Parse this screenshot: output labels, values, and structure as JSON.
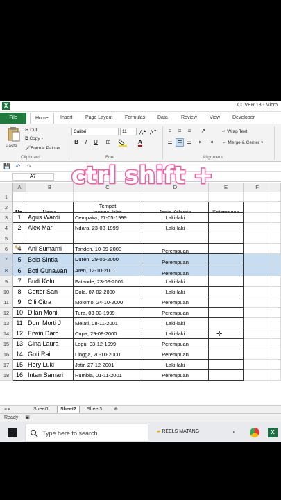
{
  "window": {
    "title": "COVER 13 - Micro"
  },
  "ribbon_tabs": [
    "File",
    "Home",
    "Insert",
    "Page Layout",
    "Formulas",
    "Data",
    "Review",
    "View",
    "Developer"
  ],
  "ribbon": {
    "clipboard": {
      "paste": "Paste",
      "cut": "Cut",
      "copy": "Copy ▾",
      "format_painter": "Format Painter",
      "group": "Clipboard"
    },
    "font": {
      "name": "Calibri",
      "size": "11",
      "group": "Font"
    },
    "alignment": {
      "wrap": "Wrap Text",
      "merge": "Merge & Center ▾",
      "group": "Alignment"
    }
  },
  "formula_bar": {
    "name_box": "A7"
  },
  "overlay_text": "ctrl shift +",
  "columns": [
    "A",
    "B",
    "C",
    "D",
    "E",
    "F"
  ],
  "headers": {
    "no": "No.",
    "nama": "Nama",
    "tempat_line1": "Tempat",
    "tempat_line2": "tanggal lahir",
    "jenis": "Jenis Kelamin",
    "ket": "Keterangan"
  },
  "rows": [
    {
      "r": "1",
      "no": "",
      "nama": "",
      "ttl": "",
      "jk": ""
    },
    {
      "r": "2",
      "no": "",
      "nama": "",
      "ttl": "",
      "jk": ""
    },
    {
      "r": "3",
      "no": "1",
      "nama": "Agus Wardi",
      "ttl": "Cempaka, 27-05-1999",
      "jk": "Laki-laki"
    },
    {
      "r": "4",
      "no": "2",
      "nama": "Alex Mar",
      "ttl": "Ndara, 23-08-1999",
      "jk": "Laki-laki"
    },
    {
      "r": "5",
      "no": "",
      "nama": "",
      "ttl": "",
      "jk": ""
    },
    {
      "r": "6",
      "no": "4",
      "nama": "Ani Sumarni",
      "ttl": "Tandeh, 10-09-2000",
      "jk": "Perempuan"
    },
    {
      "r": "7",
      "no": "5",
      "nama": "Bela Sintia",
      "ttl": "Duren, 29-06-2000",
      "jk": "Perempuan"
    },
    {
      "r": "8",
      "no": "6",
      "nama": "Boti Gunawan",
      "ttl": "Aren, 12-10-2001",
      "jk": "Perempuan"
    },
    {
      "r": "9",
      "no": "7",
      "nama": "Budi Kolu",
      "ttl": "Fatande, 23-09-2001",
      "jk": "Laki-laki"
    },
    {
      "r": "10",
      "no": "8",
      "nama": "Cetter San",
      "ttl": "Dola, 07-02-2000",
      "jk": "Laki-laki"
    },
    {
      "r": "11",
      "no": "9",
      "nama": "Cili Citra",
      "ttl": "Molomo, 24-10-2000",
      "jk": "Perempuan"
    },
    {
      "r": "12",
      "no": "10",
      "nama": "Dilan Moni",
      "ttl": "Tura, 03-03-1999",
      "jk": "Perempuan"
    },
    {
      "r": "13",
      "no": "11",
      "nama": "Doni Morti J",
      "ttl": "Melati, 08-11-2001",
      "jk": "Laki-laki"
    },
    {
      "r": "14",
      "no": "12",
      "nama": "Erwin Daro",
      "ttl": "Cupa, 29-08-2000",
      "jk": "Laki-laki"
    },
    {
      "r": "15",
      "no": "13",
      "nama": "Gina Laura",
      "ttl": "Logu, 03-12-1999",
      "jk": "Perempuan"
    },
    {
      "r": "16",
      "no": "14",
      "nama": "Goti Rai",
      "ttl": "Lingga, 20-10-2000",
      "jk": "Perempuan"
    },
    {
      "r": "17",
      "no": "15",
      "nama": "Hery Luki",
      "ttl": "Jatir, 27-12-2001",
      "jk": "Laki-laki"
    },
    {
      "r": "18",
      "no": "16",
      "nama": "Intan Samari",
      "ttl": "Rumbia, 01-11-2001",
      "jk": "Perempuan"
    }
  ],
  "sheets": [
    "Sheet1",
    "Sheet2",
    "Sheet3"
  ],
  "status": "Ready",
  "taskbar": {
    "search_placeholder": "Type here to search",
    "app_label": "REELS MATANG"
  }
}
